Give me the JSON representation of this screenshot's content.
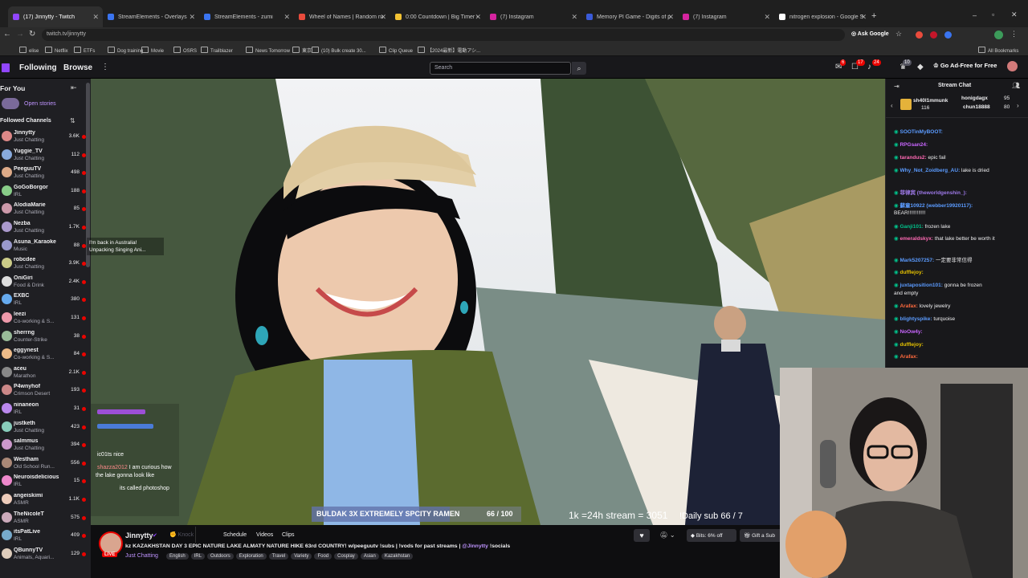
{
  "browser": {
    "tabs": [
      {
        "label": "(17) Jinnytty - Twitch",
        "color": "#9146ff",
        "active": true
      },
      {
        "label": "StreamElements - Overlays",
        "color": "#3a74f0"
      },
      {
        "label": "StreamElements - zumi",
        "color": "#3a74f0"
      },
      {
        "label": "Wheel of Names | Random nar",
        "color": "#e94b3c"
      },
      {
        "label": "0:00 Countdown | Big Timer -",
        "color": "#f2c233"
      },
      {
        "label": "(7) Instagram",
        "color": "#d6249f"
      },
      {
        "label": "Memory PI Game - Digits of pi",
        "color": "#3a5bd9"
      },
      {
        "label": "(7) Instagram",
        "color": "#d6249f"
      },
      {
        "label": "nitrogen explosion - Google Se",
        "color": "#ffffff"
      }
    ],
    "url": "twitch.tv/jinnytty",
    "ask_google": "Ask Google",
    "bookmarks": [
      "elise",
      "Netflix",
      "ETFs",
      "Dog training",
      "Movie",
      "OSRS",
      "Trailblazer",
      "News Tomorrow",
      "東京",
      "(10) Bulk create 30...",
      "Clip Queue",
      "【2024最新】電動アシ..."
    ],
    "all_bookmarks": "All Bookmarks"
  },
  "nav": {
    "following": "Following",
    "browse": "Browse",
    "search_placeholder": "Search",
    "ad_free": "Go Ad-Free for Free",
    "badges": [
      "6",
      "17",
      "24",
      "10"
    ]
  },
  "sidebar": {
    "for_you": "For You",
    "open_stories": "Open stories",
    "followed_title": "Followed Channels",
    "channels": [
      {
        "name": "Jinnytty",
        "category": "Just Chatting",
        "viewers": "3.6K",
        "color": "#d88"
      },
      {
        "name": "Yuggie_TV",
        "category": "Just Chatting",
        "viewers": "112",
        "color": "#8ad"
      },
      {
        "name": "PeeguuTV",
        "category": "Just Chatting",
        "viewers": "498",
        "color": "#da8"
      },
      {
        "name": "GoGoBorgor",
        "category": "IRL",
        "viewers": "188",
        "color": "#8c8"
      },
      {
        "name": "AlodiaMarie",
        "category": "Just Chatting",
        "viewers": "85",
        "color": "#c9a"
      },
      {
        "name": "Nezba",
        "category": "Just Chatting",
        "viewers": "1.7K",
        "color": "#a9c"
      },
      {
        "name": "Asuna_Karaoke",
        "category": "Music",
        "viewers": "88",
        "color": "#99c"
      },
      {
        "name": "robcdee",
        "category": "Just Chatting",
        "viewers": "3.9K",
        "color": "#cc8"
      },
      {
        "name": "OniGiri",
        "category": "Food & Drink",
        "viewers": "2.4K",
        "color": "#ddd"
      },
      {
        "name": "EXBC",
        "category": "IRL",
        "viewers": "380",
        "color": "#6ae"
      },
      {
        "name": "leezi",
        "category": "Co-working & S...",
        "viewers": "131",
        "color": "#e9a"
      },
      {
        "name": "sherrng",
        "category": "Counter-Strike",
        "viewers": "38",
        "color": "#9b9"
      },
      {
        "name": "eggynest",
        "category": "Co-working & S...",
        "viewers": "84",
        "color": "#eb8"
      },
      {
        "name": "aceu",
        "category": "Marathon",
        "viewers": "2.1K",
        "color": "#888"
      },
      {
        "name": "P4wnyhof",
        "category": "Crimson Desert",
        "viewers": "193",
        "color": "#c88"
      },
      {
        "name": "ninaneon",
        "category": "IRL",
        "viewers": "31",
        "color": "#b8e"
      },
      {
        "name": "justketh",
        "category": "Just Chatting",
        "viewers": "423",
        "color": "#8cb"
      },
      {
        "name": "salmmus",
        "category": "Just Chatting",
        "viewers": "394",
        "color": "#c9c"
      },
      {
        "name": "Westham",
        "category": "Old School Run...",
        "viewers": "556",
        "color": "#a87"
      },
      {
        "name": "Neuroisdelicious",
        "category": "IRL",
        "viewers": "15",
        "color": "#e8c"
      },
      {
        "name": "angeiskimi",
        "category": "ASMR",
        "viewers": "1.1K",
        "color": "#ecb"
      },
      {
        "name": "TheNicoleT",
        "category": "ASMR",
        "viewers": "575",
        "color": "#cab"
      },
      {
        "name": "itsPatLive",
        "category": "IRL",
        "viewers": "409",
        "color": "#7ac"
      },
      {
        "name": "QBunnyTV",
        "category": "Animals, Aquari...",
        "viewers": "129",
        "color": "#dcb"
      }
    ],
    "tooltip_line1": "I'm back in Australia!",
    "tooltip_line2": "Unpacking Singing Ani..."
  },
  "video": {
    "goal_label": "BULDAK 3X EXTREMELY SPCITY RAMEN",
    "goal_count": "66 / 100",
    "stream_text": "1k =24h stream = 3051",
    "daily_sub": "!Daily sub  66 / 7",
    "overlay_chat": [
      "nice",
      "I am curious how",
      "the lake gonna look like",
      "its called photoshop"
    ]
  },
  "channel_info": {
    "name": "Jinnytty",
    "knock": "Knock",
    "tabs": [
      "Schedule",
      "Videos",
      "Clips"
    ],
    "title": "KAZAKHSTAN DAY 3 EPIC NATURE LAKE ALMATY NATURE HIKE 63rd COUNTRY! w/peeguutv !subs | !vods for past streams |",
    "handle": "@Jinnytty",
    "socials": "!socials",
    "category": "Just Chatting",
    "tags": [
      "English",
      "IRL",
      "Outdoors",
      "Exploration",
      "Travel",
      "Variety",
      "Food",
      "Cosplay",
      "Asian",
      "Kazakhstan"
    ],
    "live": "LIVE",
    "bits": "Bits: 6% off",
    "gift": "Gift a Sub"
  },
  "chat": {
    "title": "Stream Chat",
    "top_gifters": [
      {
        "name": "sh40l1mmunk",
        "count": "116"
      },
      {
        "name": "honigdagx",
        "count": "95"
      },
      {
        "name": "chun18888",
        "count": "80"
      }
    ],
    "messages": [
      {
        "user": "SOOTinMyBOOT:",
        "text": "",
        "color": "#5b9bff"
      },
      {
        "user": "RPGsan24:",
        "text": "",
        "color": "#c966ff"
      },
      {
        "user": "tarandus2:",
        "text": "epic fail",
        "color": "#ff69b4"
      },
      {
        "user": "Why_Not_Zoidberg_AU:",
        "text": "lake is dried",
        "color": "#5b9bff"
      },
      {
        "user": "菲律宾 (theworldgenshin_):",
        "text": "",
        "color": "#9f7aea"
      },
      {
        "user": "蘇童10922 (webber19920117):",
        "text": "",
        "color": "#5b9bff"
      },
      {
        "user": "",
        "text": "BEAR!!!!!!!!!!!!",
        "color": "#efeff1"
      },
      {
        "user": "Ganji101:",
        "text": "frozen lake",
        "color": "#00c28b"
      },
      {
        "user": "emeraldskyx:",
        "text": "that lake better be worth it",
        "color": "#ff69b4"
      },
      {
        "user": "Mark5207257:",
        "text": "一定要非常信得",
        "color": "#5b9bff"
      },
      {
        "user": "dufflejoy:",
        "text": "",
        "color": "#e5c100"
      },
      {
        "user": "juxtaposition101:",
        "text": "gonna be frozen",
        "color": "#5b9bff"
      },
      {
        "user": "",
        "text": "and empty",
        "color": "#efeff1"
      },
      {
        "user": "Arafax:",
        "text": "lovely jewelry",
        "color": "#ff6a3d"
      },
      {
        "user": "blightyspike:",
        "text": "turquoise",
        "color": "#5b9bff"
      },
      {
        "user": "NoOw4y:",
        "text": "",
        "color": "#c966ff"
      },
      {
        "user": "dufflejoy:",
        "text": "",
        "color": "#e5c100"
      },
      {
        "user": "Arafax:",
        "text": "",
        "color": "#ff6a3d"
      }
    ]
  }
}
